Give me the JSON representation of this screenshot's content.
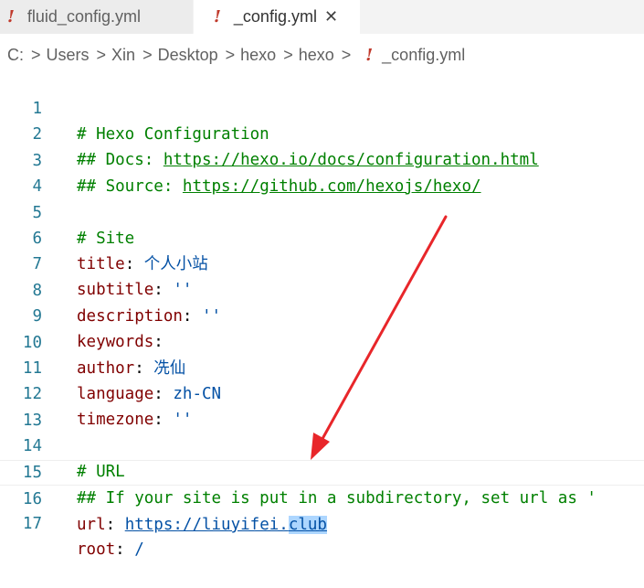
{
  "tabs": [
    {
      "label": "fluid_config.yml",
      "icon": "yaml-exclamation-icon",
      "active": false
    },
    {
      "label": "_config.yml",
      "icon": "yaml-exclamation-icon",
      "active": true,
      "close": "✕"
    }
  ],
  "file_icon_glyph": "!",
  "breadcrumb": {
    "items": [
      "C:",
      "Users",
      "Xin",
      "Desktop",
      "hexo",
      "hexo",
      "_config.yml"
    ],
    "separator": ">"
  },
  "lines": [
    {
      "n": "1",
      "comment": "# Hexo Configuration"
    },
    {
      "n": "2",
      "comment": "## Docs: ",
      "link": "https://hexo.io/docs/configuration.html"
    },
    {
      "n": "3",
      "comment": "## Source: ",
      "link": "https://github.com/hexojs/hexo/"
    },
    {
      "n": "4"
    },
    {
      "n": "5",
      "comment": "# Site"
    },
    {
      "n": "6",
      "key": "title",
      "value": "个人小站"
    },
    {
      "n": "7",
      "key": "subtitle",
      "value": "''"
    },
    {
      "n": "8",
      "key": "description",
      "value": "''"
    },
    {
      "n": "9",
      "key": "keywords",
      "value": ""
    },
    {
      "n": "10",
      "key": "author",
      "value": "冼仙"
    },
    {
      "n": "11",
      "key": "language",
      "value": "zh-CN"
    },
    {
      "n": "12",
      "key": "timezone",
      "value": "''"
    },
    {
      "n": "13"
    },
    {
      "n": "14",
      "comment": "# URL"
    },
    {
      "n": "15",
      "comment": "## If your site is put in a subdirectory, set url as '"
    },
    {
      "n": "16",
      "key": "url",
      "value_prefix": "https://liuyifei.",
      "value_selected": "club",
      "active": true
    },
    {
      "n": "17",
      "key": "root",
      "value": "/"
    }
  ],
  "colors": {
    "comment": "#008000",
    "key": "#800000",
    "value": "#0451a5",
    "line_number": "#237893",
    "selection": "#add6ff",
    "annotation_arrow": "#e8262a"
  }
}
